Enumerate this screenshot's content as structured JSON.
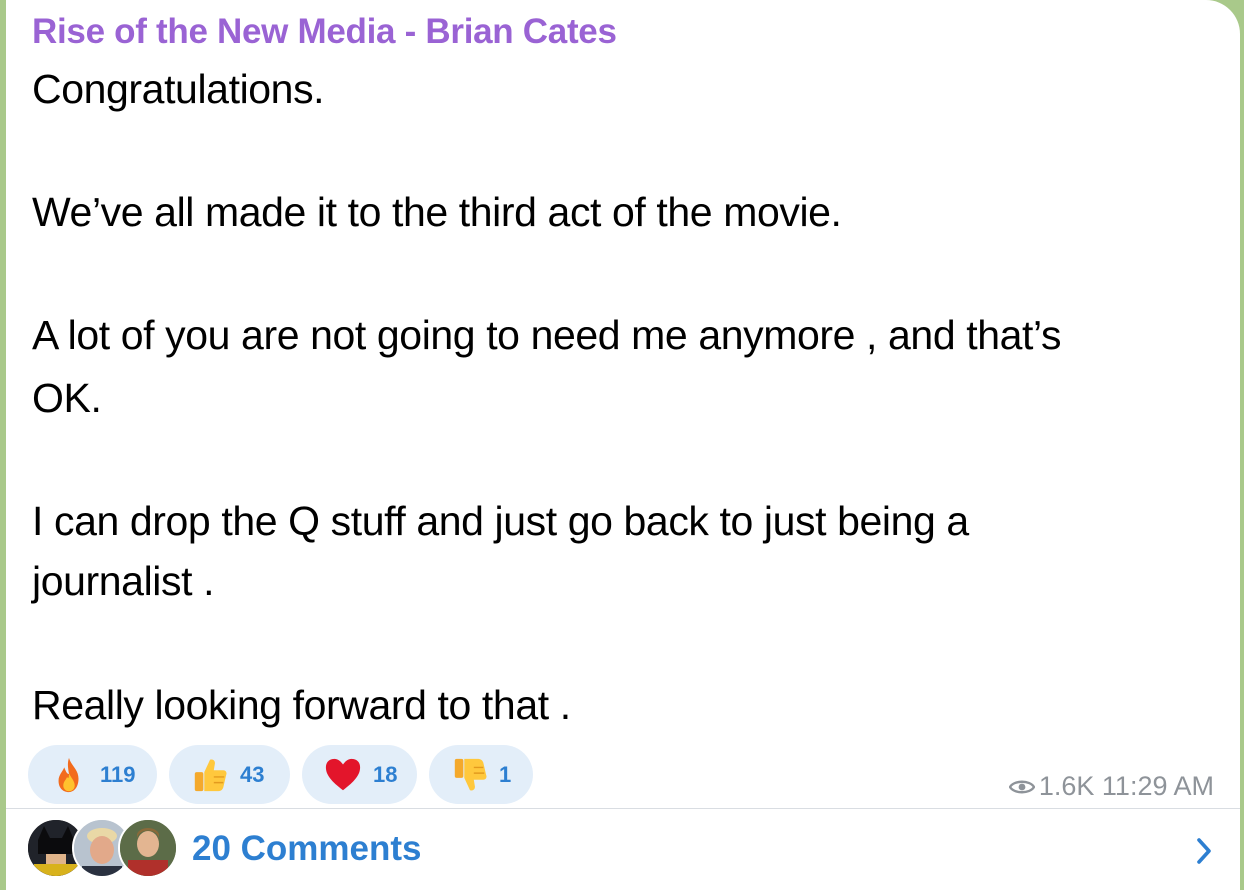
{
  "post": {
    "sender": "Rise of the New Media - Brian Cates",
    "lines": [
      "Congratulations.",
      "We’ve all made it to the third act of the movie.",
      "A lot of you are not going to need me anymore , and that’s",
      "OK.",
      "I can drop the Q stuff and just go back to just being a",
      "journalist .",
      "Really looking forward to that ."
    ]
  },
  "reactions": [
    {
      "icon": "fire-icon",
      "count": "119"
    },
    {
      "icon": "thumbs-up-icon",
      "count": "43"
    },
    {
      "icon": "heart-icon",
      "count": "18"
    },
    {
      "icon": "thumbs-down-icon",
      "count": "1"
    }
  ],
  "meta": {
    "views": "1.6K",
    "time": "11:29 AM",
    "view_icon": "eye-icon"
  },
  "footer": {
    "comments_label": "20 Comments",
    "chevron_icon": "chevron-right-icon"
  },
  "colors": {
    "sender": "#9a63d4",
    "accent": "#2d7fd1",
    "chip_bg": "#e3eef9",
    "meta": "#8e9399"
  }
}
